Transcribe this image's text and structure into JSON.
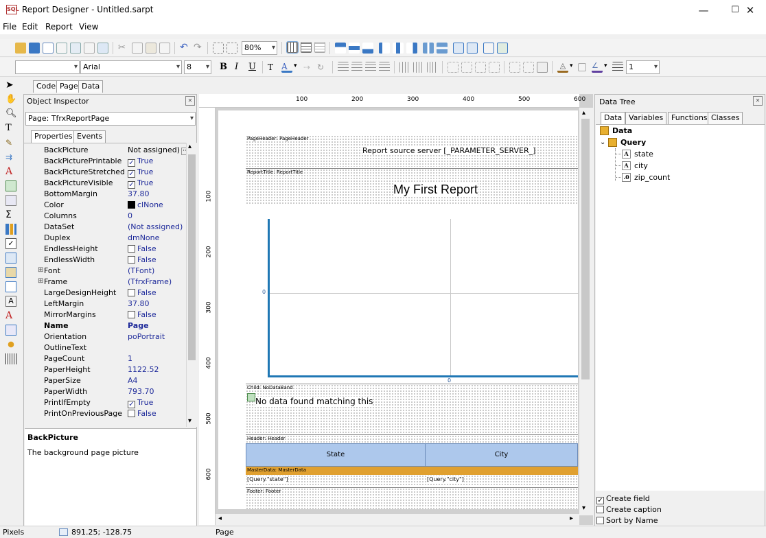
{
  "window": {
    "title": "Report Designer - Untitled.sarpt",
    "app_icon_text": "SQL"
  },
  "menu": [
    "File",
    "Edit",
    "Report",
    "View"
  ],
  "toolbar": {
    "zoom": "80%"
  },
  "format_toolbar": {
    "font_name": "Arial",
    "font_size": "8",
    "line_width": "1",
    "bold": "B",
    "italic": "I",
    "underline": "U"
  },
  "tabs": [
    "Code",
    "Page",
    "Data"
  ],
  "object_inspector": {
    "title": "Object Inspector",
    "selector": "Page: TfrxReportPage",
    "tabs": [
      "Properties",
      "Events"
    ],
    "properties": [
      {
        "name": "BackPicture",
        "value": "Not assigned)",
        "kind": "ellipsis"
      },
      {
        "name": "BackPicturePrintable",
        "value": "True",
        "kind": "check",
        "checked": true
      },
      {
        "name": "BackPictureStretched",
        "value": "True",
        "kind": "check",
        "checked": true
      },
      {
        "name": "BackPictureVisible",
        "value": "True",
        "kind": "check",
        "checked": true
      },
      {
        "name": "BottomMargin",
        "value": "37.80",
        "kind": "text"
      },
      {
        "name": "Color",
        "value": "clNone",
        "kind": "color"
      },
      {
        "name": "Columns",
        "value": "0",
        "kind": "text"
      },
      {
        "name": "DataSet",
        "value": "(Not assigned)",
        "kind": "text"
      },
      {
        "name": "Duplex",
        "value": "dmNone",
        "kind": "text"
      },
      {
        "name": "EndlessHeight",
        "value": "False",
        "kind": "check",
        "checked": false
      },
      {
        "name": "EndlessWidth",
        "value": "False",
        "kind": "check",
        "checked": false
      },
      {
        "name": "Font",
        "value": "(TFont)",
        "kind": "expand"
      },
      {
        "name": "Frame",
        "value": "(TfrxFrame)",
        "kind": "expand"
      },
      {
        "name": "LargeDesignHeight",
        "value": "False",
        "kind": "check",
        "checked": false
      },
      {
        "name": "LeftMargin",
        "value": "37.80",
        "kind": "text"
      },
      {
        "name": "MirrorMargins",
        "value": "False",
        "kind": "check",
        "checked": false
      },
      {
        "name": "Name",
        "value": "Page",
        "kind": "bold"
      },
      {
        "name": "Orientation",
        "value": "poPortrait",
        "kind": "text"
      },
      {
        "name": "OutlineText",
        "value": "",
        "kind": "text"
      },
      {
        "name": "PageCount",
        "value": "1",
        "kind": "text"
      },
      {
        "name": "PaperHeight",
        "value": "1122.52",
        "kind": "text"
      },
      {
        "name": "PaperSize",
        "value": "A4",
        "kind": "text"
      },
      {
        "name": "PaperWidth",
        "value": "793.70",
        "kind": "text"
      },
      {
        "name": "PrintIfEmpty",
        "value": "True",
        "kind": "check",
        "checked": true
      },
      {
        "name": "PrintOnPreviousPage",
        "value": "False",
        "kind": "check",
        "checked": false
      }
    ],
    "help_title": "BackPicture",
    "help_text": "The background page picture"
  },
  "ruler": {
    "top": [
      "100",
      "200",
      "300",
      "400",
      "500",
      "600"
    ],
    "left": [
      "100",
      "200",
      "300",
      "400",
      "500",
      "600"
    ]
  },
  "report": {
    "page_header_label": "PageHeader:",
    "page_header_name": "PageHeader",
    "page_header_text": "Report source server  [_PARAMETER_SERVER_]",
    "report_title_label": "ReportTitle:",
    "report_title_name": "ReportTitle",
    "report_title_text": "My First Report",
    "chart_y_zero": "0",
    "chart_x_zero": "0",
    "child_label": "Child:",
    "child_name": "NoDataBand",
    "no_data_text": "No data found matching this",
    "header_label": "Header:",
    "header_name": "Header",
    "col_state": "State",
    "col_city": "City",
    "master_label": "MasterData:",
    "master_name": "MasterData",
    "field_state": "[Query.\"state\"]",
    "field_city": "[Query.\"city\"]",
    "footer_label": "Footer:",
    "footer_name": "Footer"
  },
  "data_tree": {
    "title": "Data Tree",
    "tabs": [
      "Data",
      "Variables",
      "Functions",
      "Classes"
    ],
    "root": "Data",
    "query": "Query",
    "fields": [
      {
        "name": "state",
        "type_glyph": "A"
      },
      {
        "name": "city",
        "type_glyph": "A"
      },
      {
        "name": "zip_count",
        "type_glyph": ".0"
      }
    ],
    "options": [
      {
        "label": "Create field",
        "checked": true
      },
      {
        "label": "Create caption",
        "checked": false
      },
      {
        "label": "Sort by Name",
        "checked": false
      }
    ]
  },
  "status": {
    "units": "Pixels",
    "coords": "891.25; -128.75",
    "object": "Page"
  }
}
